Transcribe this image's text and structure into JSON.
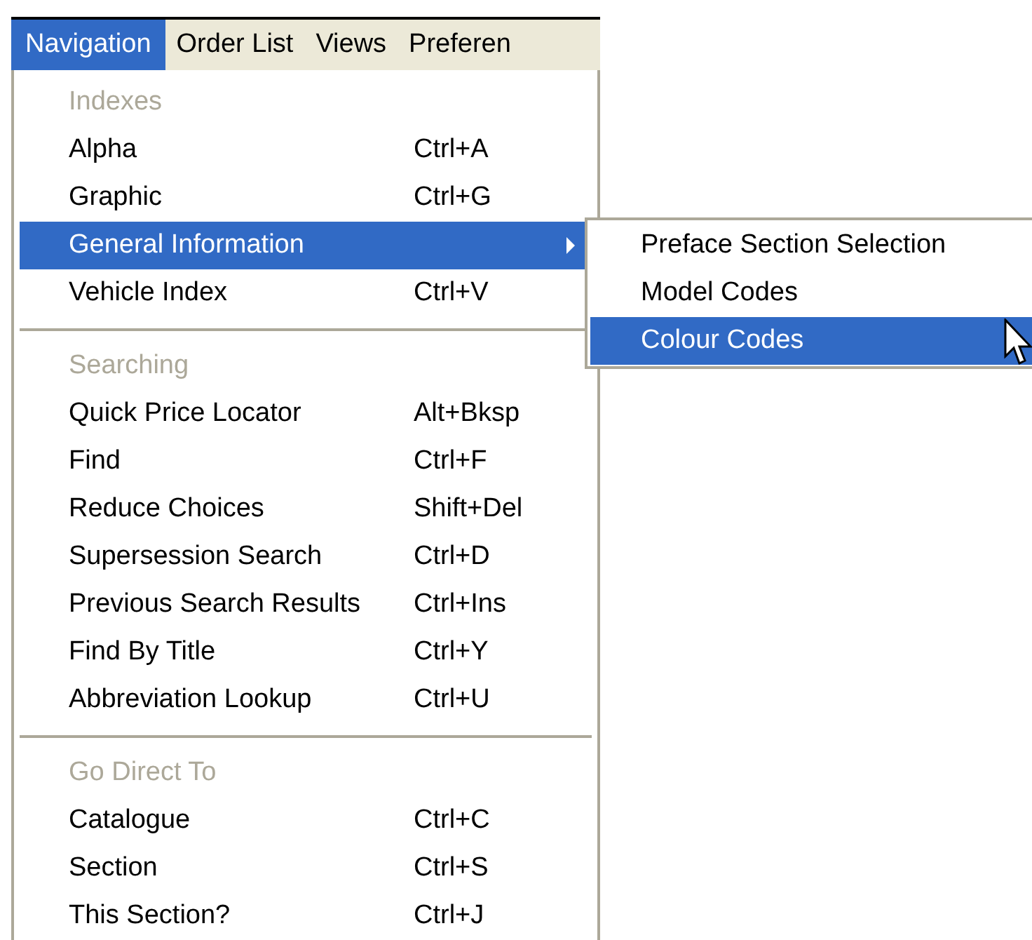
{
  "menu_bar": [
    {
      "label": "Navigation",
      "selected": true
    },
    {
      "label": "Order List",
      "selected": false
    },
    {
      "label": "Views",
      "selected": false
    },
    {
      "label": "Preferen",
      "selected": false
    }
  ],
  "menu": [
    {
      "kind": "header",
      "label": "Indexes"
    },
    {
      "kind": "item",
      "label": "Alpha",
      "shortcut": "Ctrl+A",
      "selected": false
    },
    {
      "kind": "item",
      "label": "Graphic",
      "shortcut": "Ctrl+G",
      "selected": false
    },
    {
      "kind": "submenu",
      "label": "General Information",
      "selected": true
    },
    {
      "kind": "item",
      "label": "Vehicle Index",
      "shortcut": "Ctrl+V",
      "selected": false
    },
    {
      "kind": "separator"
    },
    {
      "kind": "header",
      "label": "Searching"
    },
    {
      "kind": "item",
      "label": "Quick Price Locator",
      "shortcut": "Alt+Bksp",
      "selected": false
    },
    {
      "kind": "item",
      "label": "Find",
      "shortcut": "Ctrl+F",
      "selected": false
    },
    {
      "kind": "item",
      "label": "Reduce Choices",
      "shortcut": "Shift+Del",
      "selected": false
    },
    {
      "kind": "item",
      "label": "Supersession Search",
      "shortcut": "Ctrl+D",
      "selected": false
    },
    {
      "kind": "item",
      "label": "Previous Search Results",
      "shortcut": "Ctrl+Ins",
      "selected": false
    },
    {
      "kind": "item",
      "label": "Find By Title",
      "shortcut": "Ctrl+Y",
      "selected": false
    },
    {
      "kind": "item",
      "label": "Abbreviation Lookup",
      "shortcut": "Ctrl+U",
      "selected": false
    },
    {
      "kind": "separator"
    },
    {
      "kind": "header",
      "label": "Go Direct To"
    },
    {
      "kind": "item",
      "label": "Catalogue",
      "shortcut": "Ctrl+C",
      "selected": false
    },
    {
      "kind": "item",
      "label": "Section",
      "shortcut": "Ctrl+S",
      "selected": false
    },
    {
      "kind": "item",
      "label": "This Section?",
      "shortcut": "Ctrl+J",
      "selected": false
    }
  ],
  "submenu": [
    {
      "label": "Preface Section Selection",
      "selected": false
    },
    {
      "label": "Model Codes",
      "selected": false
    },
    {
      "label": "Colour Codes",
      "selected": true
    }
  ]
}
